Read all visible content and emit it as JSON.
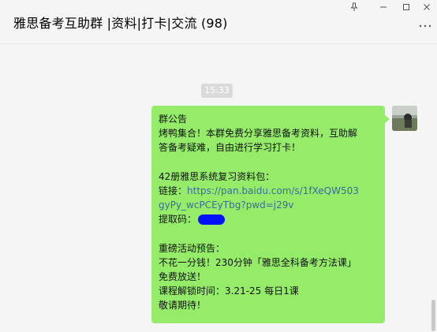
{
  "window": {
    "title": "雅思备考互助群 |资料|打卡|交流 (98)",
    "controls": {
      "pin_icon": "pin-icon",
      "minimize_icon": "minimize-icon",
      "maximize_icon": "maximize-icon",
      "close_icon": "close-icon",
      "more_icon": "more-icon"
    }
  },
  "chat": {
    "timestamp": "15:33",
    "message": {
      "lines": [
        "群公告",
        "烤鸭集合！本群免费分享雅思备考资料，互助解",
        "答备考疑难，自由进行学习打卡！",
        "",
        "42册雅思系统复习资料包：",
        "链接：",
        "https://pan.baidu.com/s/1fXeQW503",
        "gyPy_wcPCEyTbg?pwd=j29v",
        "提取码：",
        "",
        "重磅活动预告：",
        "不花一分钱！230分钟「雅思全科备考方法课」",
        "免费放送！",
        "课程解锁时间：3.21-25 每日1课",
        "敬请期待！"
      ]
    },
    "sender_avatar": "avatar-icon"
  },
  "colors": {
    "bubble": "#95ec69",
    "link": "#3d6aa4",
    "background": "#f5f5f5",
    "redaction": "#0011ff"
  }
}
